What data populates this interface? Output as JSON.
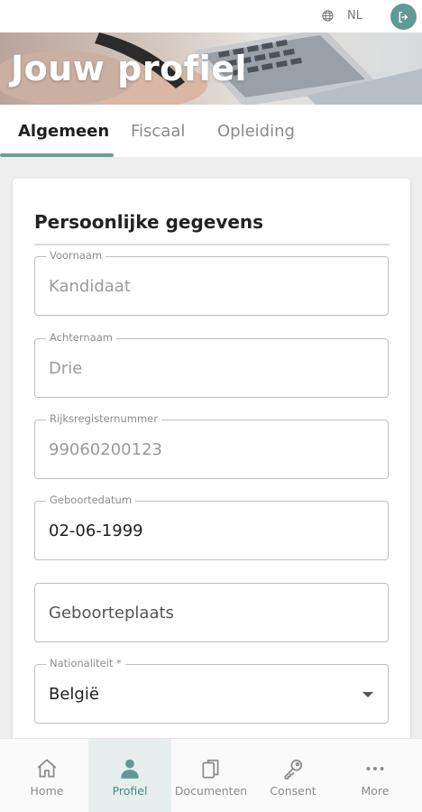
{
  "header": {
    "language": "NL",
    "icons": {
      "language": "globe-icon",
      "logout": "logout-icon"
    }
  },
  "hero": {
    "title": "Jouw profiel"
  },
  "tabs": [
    {
      "label": "Algemeen",
      "active": true
    },
    {
      "label": "Fiscaal",
      "active": false
    },
    {
      "label": "Opleiding",
      "active": false
    }
  ],
  "section": {
    "title": "Persoonlijke gegevens",
    "fields": [
      {
        "label": "Voornaam",
        "value": "Kandidaat"
      },
      {
        "label": "Achternaam",
        "value": "Drie"
      },
      {
        "label": "Rijksregisternummer",
        "value": "99060200123"
      },
      {
        "label": "Geboortedatum",
        "value": "02-06-1999"
      },
      {
        "label": "",
        "placeholder": "Geboorteplaats"
      },
      {
        "label": "Nationaliteit *",
        "value": "België"
      }
    ]
  },
  "bottom_nav": [
    {
      "label": "Home",
      "icon": "home-icon"
    },
    {
      "label": "Profiel",
      "icon": "person-icon",
      "active": true
    },
    {
      "label": "Documenten",
      "icon": "documents-icon"
    },
    {
      "label": "Consent",
      "icon": "key-icon"
    },
    {
      "label": "More",
      "icon": "more-icon"
    }
  ],
  "colors": {
    "accent": "#5f9a94",
    "active_nav_bg": "#e7efee",
    "page_bg": "#eeeeee"
  }
}
